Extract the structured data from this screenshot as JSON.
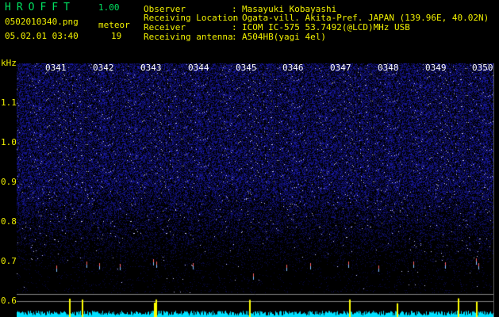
{
  "header": {
    "app_title": "HROFFT",
    "app_version": "1.00",
    "file_name": "0502010340.png",
    "meteor_label": "meteor",
    "datetime": "05.02.01 03:40",
    "meteor_count": "19"
  },
  "station_info": [
    {
      "label": "Observer",
      "value": "Masayuki Kobayashi"
    },
    {
      "label": "Receiving Location",
      "value": "Ogata-vill. Akita-Pref. JAPAN (139.96E, 40.02N)"
    },
    {
      "label": "Receiver",
      "value": "ICOM IC-575 53.7492(@LCD)MHz USB"
    },
    {
      "label": "Receiving antenna",
      "value": "A504HB(yagi 4el)"
    }
  ],
  "spectrogram": {
    "unit_label": "kHz",
    "freq_ticks": [
      "1.1",
      "1.0",
      "0.9",
      "0.8",
      "0.7",
      "0.6"
    ],
    "time_ticks": [
      "0341",
      "0342",
      "0343",
      "0344",
      "0345",
      "0346",
      "0347",
      "0348",
      "0349",
      "0350"
    ]
  },
  "colors": {
    "label_green": "#00e060",
    "label_yellow": "#f0f000",
    "noise_blue": "#1a1aa0",
    "meteor_trace": "#ffff00",
    "baseline_cyan": "#00e0ff"
  }
}
